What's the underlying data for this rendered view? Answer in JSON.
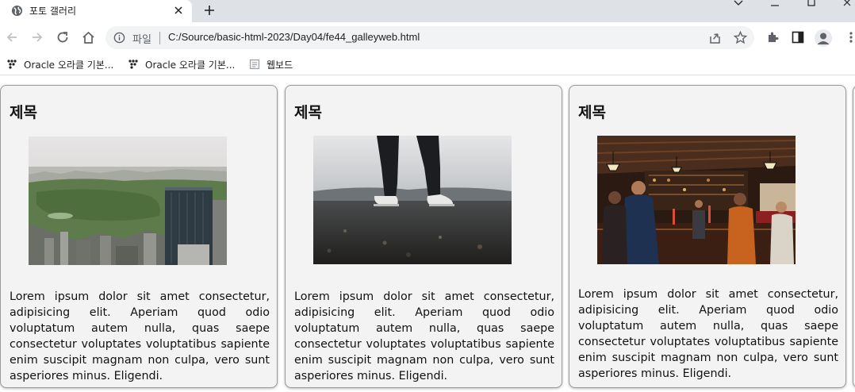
{
  "tab": {
    "title": "포토 갤러리",
    "favicon": "globe-icon"
  },
  "toolbar": {
    "scheme_label": "파일",
    "url": "C:/Source/basic-html-2023/Day04/fe44_galleyweb.html"
  },
  "bookmarks": [
    {
      "label": "Oracle 오라클 기본...",
      "icon": "oracle-icon"
    },
    {
      "label": "Oracle 오라클 기본...",
      "icon": "oracle-icon"
    },
    {
      "label": "웹보드",
      "icon": "page-icon"
    }
  ],
  "cards": [
    {
      "title": "제목",
      "image": "city-park-aerial-photo",
      "text": "Lorem ipsum dolor sit amet consectetur, adipisicing elit. Aperiam quod odio voluptatum autem nulla, quas saepe consectetur voluptates voluptatibus sapiente enim suscipit magnam non culpa, vero sunt asperiores minus. Eligendi."
    },
    {
      "title": "제목",
      "image": "legs-sneakers-photo",
      "text": "Lorem ipsum dolor sit amet consectetur, adipisicing elit. Aperiam quod odio voluptatum autem nulla, quas saepe consectetur voluptates voluptatibus sapiente enim suscipit magnam non culpa, vero sunt asperiores minus. Eligendi."
    },
    {
      "title": "제목",
      "image": "bar-interior-photo",
      "text": "Lorem ipsum dolor sit amet consectetur, adipisicing elit. Aperiam quod odio voluptatum autem nulla, quas saepe consectetur voluptates voluptatibus sapiente enim suscipit magnam non culpa, vero sunt asperiores minus. Eligendi."
    }
  ],
  "colors": {
    "tabstrip": "#dee1e6",
    "card_bg": "#f3f3f3",
    "omnibox": "#f1f3f4"
  }
}
